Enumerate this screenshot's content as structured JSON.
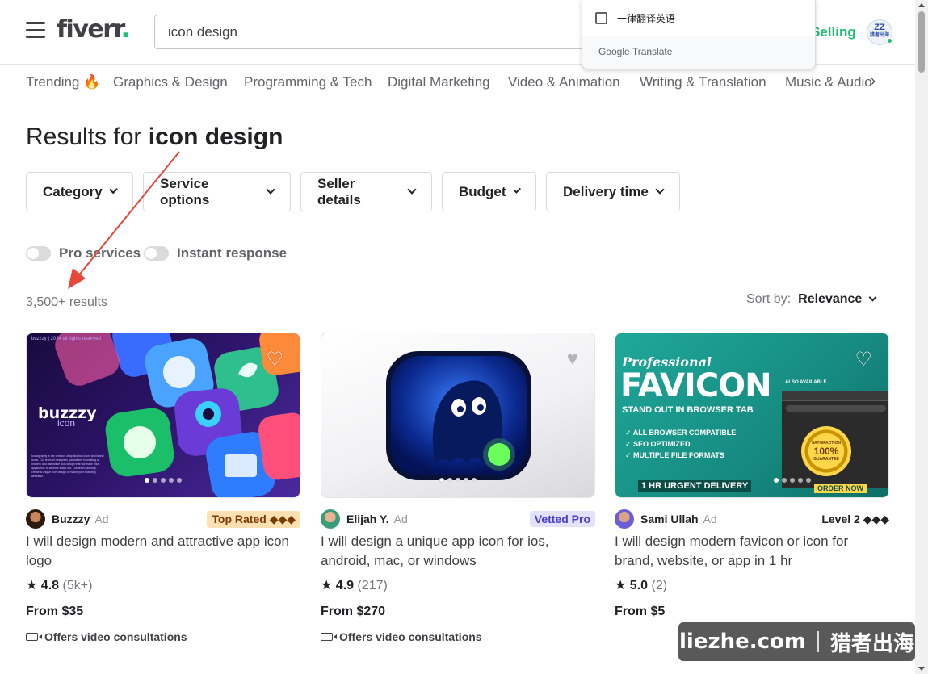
{
  "header": {
    "logo": "fiverr",
    "logo_dot": ".",
    "search_value": "icon design",
    "selling": "Selling",
    "avatar_text": "猎者出海"
  },
  "translate_popup": {
    "checkbox_label": "一律翻译英语",
    "footer": "Google Translate"
  },
  "categories": [
    {
      "label": "Trending"
    },
    {
      "label": "Graphics & Design"
    },
    {
      "label": "Programming & Tech"
    },
    {
      "label": "Digital Marketing"
    },
    {
      "label": "Video & Animation"
    },
    {
      "label": "Writing & Translation"
    },
    {
      "label": "Music & Audio"
    }
  ],
  "results": {
    "prefix": "Results for",
    "query": "icon design",
    "count": "3,500+ results"
  },
  "filters": [
    "Category",
    "Service options",
    "Seller details",
    "Budget",
    "Delivery time"
  ],
  "toggles": [
    "Pro services",
    "Instant response"
  ],
  "sort": {
    "label": "Sort by:",
    "value": "Relevance"
  },
  "gigs": [
    {
      "seller": "Buzzzy",
      "ad": "Ad",
      "badge": "Top Rated ◆◆◆",
      "title": "I will design modern and attractive app icon logo",
      "rating": "4.8",
      "reviews": "(5k+)",
      "price": "From $35",
      "video": "Offers video consultations",
      "thumb_text": "buzzzy",
      "thumb_subtext": "icon",
      "thumb_header": "buzzzy | 2024 all rights reserved",
      "thumb_blurb": "Iconography is the creation of application icons and brand icons. Our team of designers specializes in creating a modern and distinctive icon design that will make your application or website stand out. Our team can help create a unique icon design to match your branding aesthetic."
    },
    {
      "seller": "Elijah Y.",
      "ad": "Ad",
      "badge": "Vetted Pro",
      "title": "I will design a unique app icon for ios, android, mac, or windows",
      "rating": "4.9",
      "reviews": "(217)",
      "price": "From $270",
      "video": "Offers video consultations"
    },
    {
      "seller": "Sami Ullah",
      "ad": "Ad",
      "badge": "Level 2 ◆◆◆",
      "title": "I will design modern favicon or icon for brand, website, or app in 1 hr",
      "rating": "5.0",
      "reviews": "(2)",
      "price": "From $5",
      "video": "",
      "thumb_lines": [
        "Professional",
        "FAVICON",
        "STAND OUT IN BROWSER TAB",
        "ALL BROWSER COMPATIBLE",
        "SEO OPTIMIZED",
        "MULTIPLE FILE FORMATS",
        "1 HR URGENT DELIVERY",
        "ORDER NOW",
        "SATISFACTION",
        "100%",
        "GUARANTEE",
        "ALSO AVAILABLE"
      ]
    }
  ],
  "watermark": {
    "left": "liezhe.com",
    "right": "猎者出海"
  },
  "colors": {
    "brand_green": "#1dbf73",
    "badge_top_rated_bg": "#ffe0b3",
    "badge_vetted_bg": "#e3e1fc",
    "annotation_arrow": "#e8473b"
  },
  "icons": [
    "hamburger-icon",
    "fire-icon",
    "chevron-right-icon",
    "chevron-down-icon",
    "heart-icon",
    "star-icon",
    "video-icon"
  ]
}
